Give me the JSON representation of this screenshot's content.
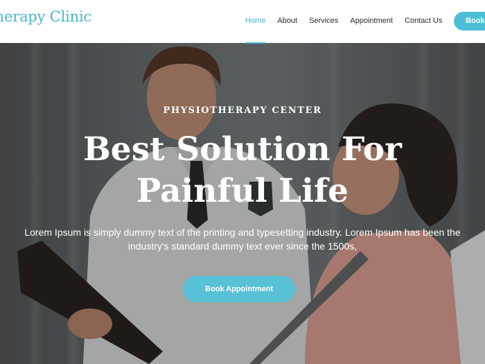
{
  "header": {
    "brand": "otherapy Clinic",
    "nav": [
      {
        "label": "Home",
        "active": true
      },
      {
        "label": "About",
        "active": false
      },
      {
        "label": "Services",
        "active": false
      },
      {
        "label": "Appointment",
        "active": false
      },
      {
        "label": "Contact Us",
        "active": false
      }
    ],
    "book_label": "Book"
  },
  "hero": {
    "eyebrow": "PHYSIOTHERAPY CENTER",
    "title": "Best Solution For Painful Life",
    "description": "Lorem Ipsum is simply dummy text of the printing and typesetting industry. Lorem Ipsum has been the industry's standard dummy text ever since the 1500s,",
    "cta_label": "Book Appointment"
  },
  "colors": {
    "accent": "#45b7c9",
    "button": "#58c1d6",
    "nav_text": "#2a2a2a"
  }
}
